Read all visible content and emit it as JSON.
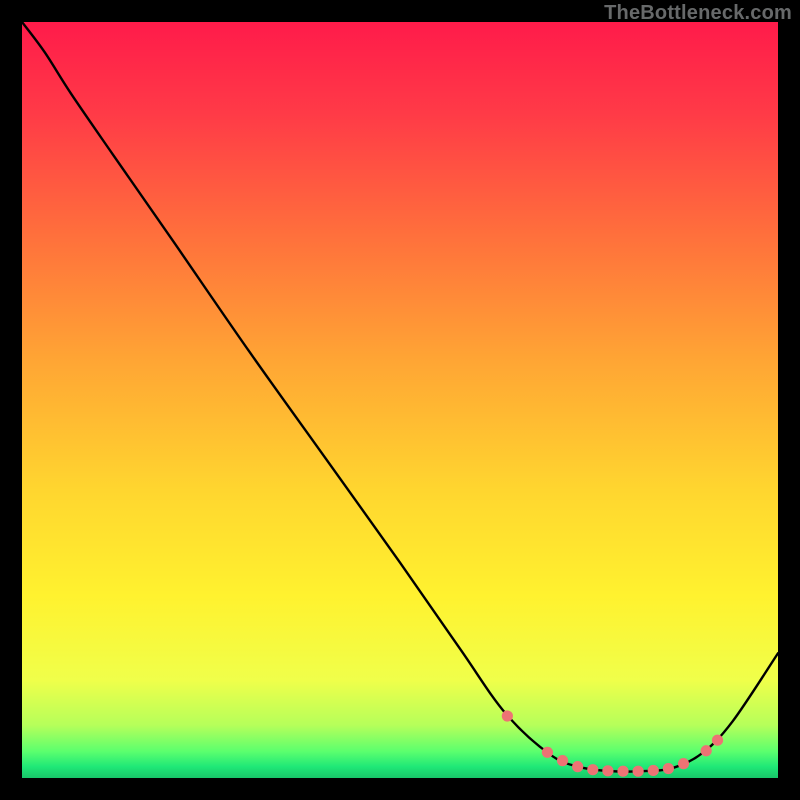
{
  "attribution": "TheBottleneck.com",
  "colors": {
    "curve": "#000000",
    "marker_fill": "#ed7374",
    "marker_stroke": "#ed7374"
  },
  "chart_data": {
    "type": "line",
    "xrange": [
      0,
      100
    ],
    "yrange": [
      0,
      100
    ],
    "gradient_stops": [
      {
        "pos": 0.0,
        "color": "#ff1b4a"
      },
      {
        "pos": 0.12,
        "color": "#ff3a47"
      },
      {
        "pos": 0.28,
        "color": "#ff6f3c"
      },
      {
        "pos": 0.45,
        "color": "#ffa634"
      },
      {
        "pos": 0.62,
        "color": "#ffd62f"
      },
      {
        "pos": 0.76,
        "color": "#fff22f"
      },
      {
        "pos": 0.87,
        "color": "#f0ff4a"
      },
      {
        "pos": 0.93,
        "color": "#b6ff5a"
      },
      {
        "pos": 0.965,
        "color": "#5bff6e"
      },
      {
        "pos": 0.985,
        "color": "#1fe877"
      },
      {
        "pos": 1.0,
        "color": "#18c569"
      }
    ],
    "curve": [
      {
        "x": 0.0,
        "y": 100.0
      },
      {
        "x": 3.0,
        "y": 96.0
      },
      {
        "x": 6.5,
        "y": 90.5
      },
      {
        "x": 12.0,
        "y": 82.5
      },
      {
        "x": 20.0,
        "y": 71.0
      },
      {
        "x": 30.0,
        "y": 56.5
      },
      {
        "x": 40.0,
        "y": 42.5
      },
      {
        "x": 50.0,
        "y": 28.5
      },
      {
        "x": 58.0,
        "y": 17.0
      },
      {
        "x": 64.0,
        "y": 8.5
      },
      {
        "x": 70.0,
        "y": 3.0
      },
      {
        "x": 74.0,
        "y": 1.4
      },
      {
        "x": 78.0,
        "y": 0.9
      },
      {
        "x": 82.0,
        "y": 0.9
      },
      {
        "x": 86.0,
        "y": 1.3
      },
      {
        "x": 90.0,
        "y": 3.3
      },
      {
        "x": 94.0,
        "y": 7.5
      },
      {
        "x": 100.0,
        "y": 16.5
      }
    ],
    "markers": [
      {
        "x": 64.2,
        "y": 8.2
      },
      {
        "x": 69.5,
        "y": 3.4
      },
      {
        "x": 71.5,
        "y": 2.3
      },
      {
        "x": 73.5,
        "y": 1.5
      },
      {
        "x": 75.5,
        "y": 1.1
      },
      {
        "x": 77.5,
        "y": 0.95
      },
      {
        "x": 79.5,
        "y": 0.9
      },
      {
        "x": 81.5,
        "y": 0.9
      },
      {
        "x": 83.5,
        "y": 1.0
      },
      {
        "x": 85.5,
        "y": 1.25
      },
      {
        "x": 87.5,
        "y": 1.9
      },
      {
        "x": 90.5,
        "y": 3.6
      },
      {
        "x": 92.0,
        "y": 5.0
      }
    ],
    "marker_radius": 5.6
  }
}
